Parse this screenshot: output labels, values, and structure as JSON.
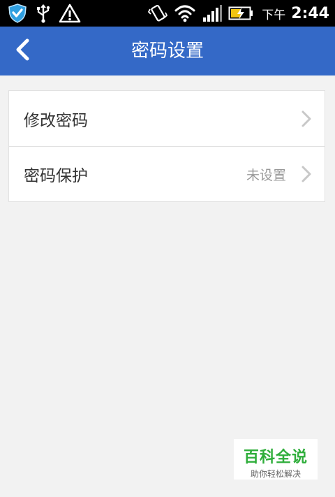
{
  "status_bar": {
    "time_period": "下午",
    "time": "2:44",
    "left_icons": [
      "shield-icon",
      "usb-icon",
      "warning-icon"
    ],
    "right_icons": [
      "vibrate-icon",
      "wifi-icon",
      "signal-icon",
      "battery-charging-icon"
    ]
  },
  "header": {
    "title": "密码设置",
    "background_color": "#3469c7"
  },
  "settings": {
    "items": [
      {
        "label": "修改密码",
        "value": ""
      },
      {
        "label": "密码保护",
        "value": "未设置"
      }
    ]
  },
  "watermark": {
    "title": "百科全说",
    "subtitle": "助你轻松解决"
  }
}
